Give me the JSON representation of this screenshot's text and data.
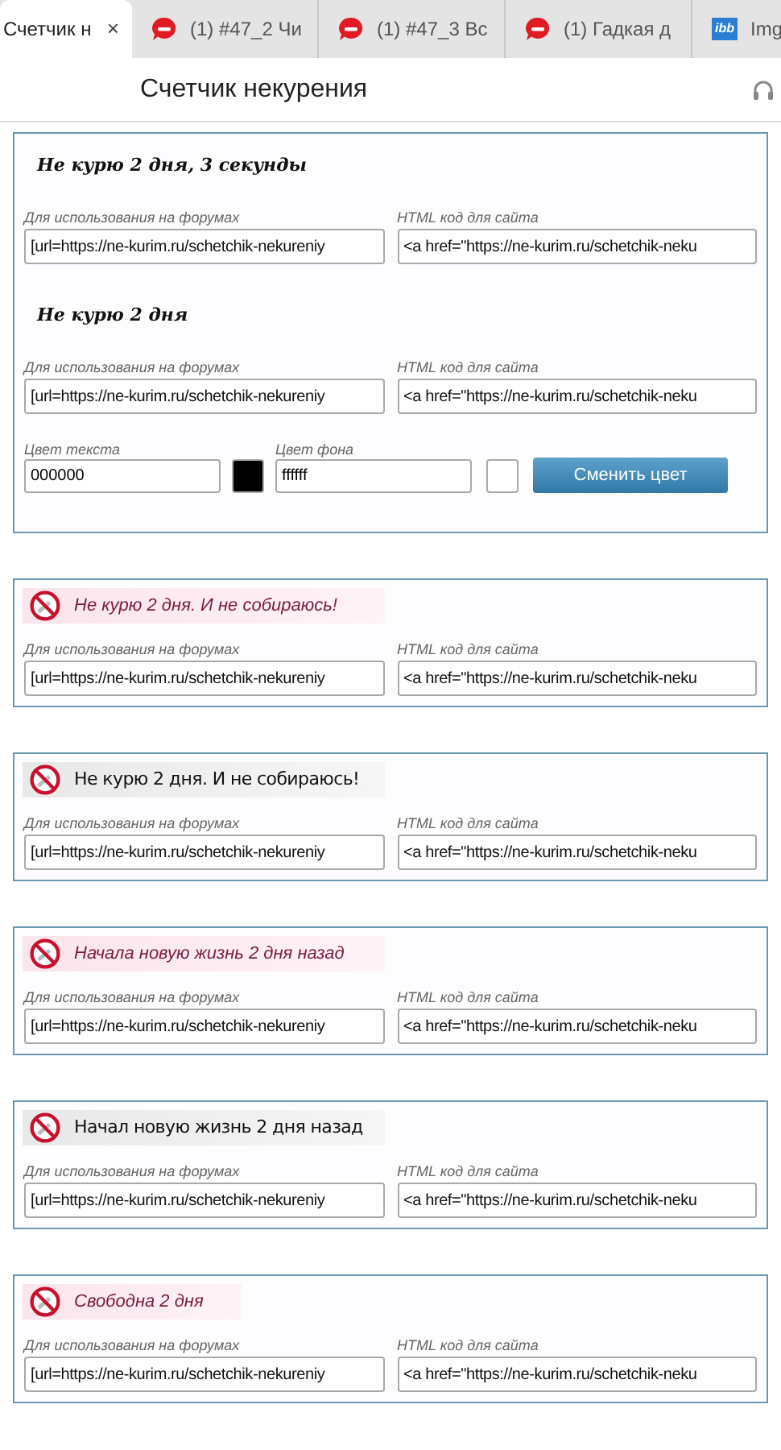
{
  "browser_tabs": [
    {
      "title": "Счетчик н",
      "selected": true,
      "kind": "plain",
      "close": "×"
    },
    {
      "title": "(1) #47_2 Чи",
      "selected": false,
      "kind": "bubble"
    },
    {
      "title": "(1) #47_3 Вс",
      "selected": false,
      "kind": "bubble"
    },
    {
      "title": "(1) Гадкая д",
      "selected": false,
      "kind": "bubble"
    },
    {
      "title": "Img",
      "selected": false,
      "kind": "logo",
      "logo_text": "ibb"
    }
  ],
  "page_header": {
    "title": "Счетчик некурения"
  },
  "main_card": {
    "counters": [
      {
        "text": "Не курю  2 дня, 3 секунды",
        "forum_label": "Для использования на форумах",
        "forum_value": "[url=https://ne-kurim.ru/schetchik-nekureniy",
        "html_label": "HTML код для сайта",
        "html_value": "<a href=\"https://ne-kurim.ru/schetchik-neku"
      },
      {
        "text": "Не курю  2 дня",
        "forum_label": "Для использования на форумах",
        "forum_value": "[url=https://ne-kurim.ru/schetchik-nekureniy",
        "html_label": "HTML код для сайта",
        "html_value": "<a href=\"https://ne-kurim.ru/schetchik-neku"
      }
    ],
    "text_color": {
      "label": "Цвет текста",
      "value": "000000",
      "color": "#000000"
    },
    "background_color": {
      "label": "Цвет фона",
      "value": "ffffff",
      "color": "#ffffff"
    },
    "button": "Сменить цвет"
  },
  "banner_cards": [
    {
      "text": "Не курю 2 дня. И не собираюсь!",
      "kind": "pink",
      "italic": true,
      "forum_label": "Для использования на форумах",
      "forum_value": "[url=https://ne-kurim.ru/schetchik-nekureniy",
      "html_label": "HTML код для сайта",
      "html_value": "<a href=\"https://ne-kurim.ru/schetchik-neku"
    },
    {
      "text": "Не курю 2 дня. И не собираюсь!",
      "kind": "gray",
      "italic": false,
      "forum_label": "Для использования на форумах",
      "forum_value": "[url=https://ne-kurim.ru/schetchik-nekureniy",
      "html_label": "HTML код для сайта",
      "html_value": "<a href=\"https://ne-kurim.ru/schetchik-neku"
    },
    {
      "text": "Начала новую жизнь 2 дня назад",
      "kind": "pink",
      "italic": true,
      "forum_label": "Для использования на форумах",
      "forum_value": "[url=https://ne-kurim.ru/schetchik-nekureniy",
      "html_label": "HTML код для сайта",
      "html_value": "<a href=\"https://ne-kurim.ru/schetchik-neku"
    },
    {
      "text": "Начал новую жизнь 2 дня назад",
      "kind": "gray",
      "italic": false,
      "forum_label": "Для использования на форумах",
      "forum_value": "[url=https://ne-kurim.ru/schetchik-nekureniy",
      "html_label": "HTML код для сайта",
      "html_value": "<a href=\"https://ne-kurim.ru/schetchik-neku"
    },
    {
      "text": "Свободна 2 дня",
      "kind": "pink",
      "italic": true,
      "forum_label": "Для использования на форумах",
      "forum_value": "[url=https://ne-kurim.ru/schetchik-nekureniy",
      "html_label": "HTML код для сайта",
      "html_value": "<a href=\"https://ne-kurim.ru/schetchik-neku"
    }
  ]
}
